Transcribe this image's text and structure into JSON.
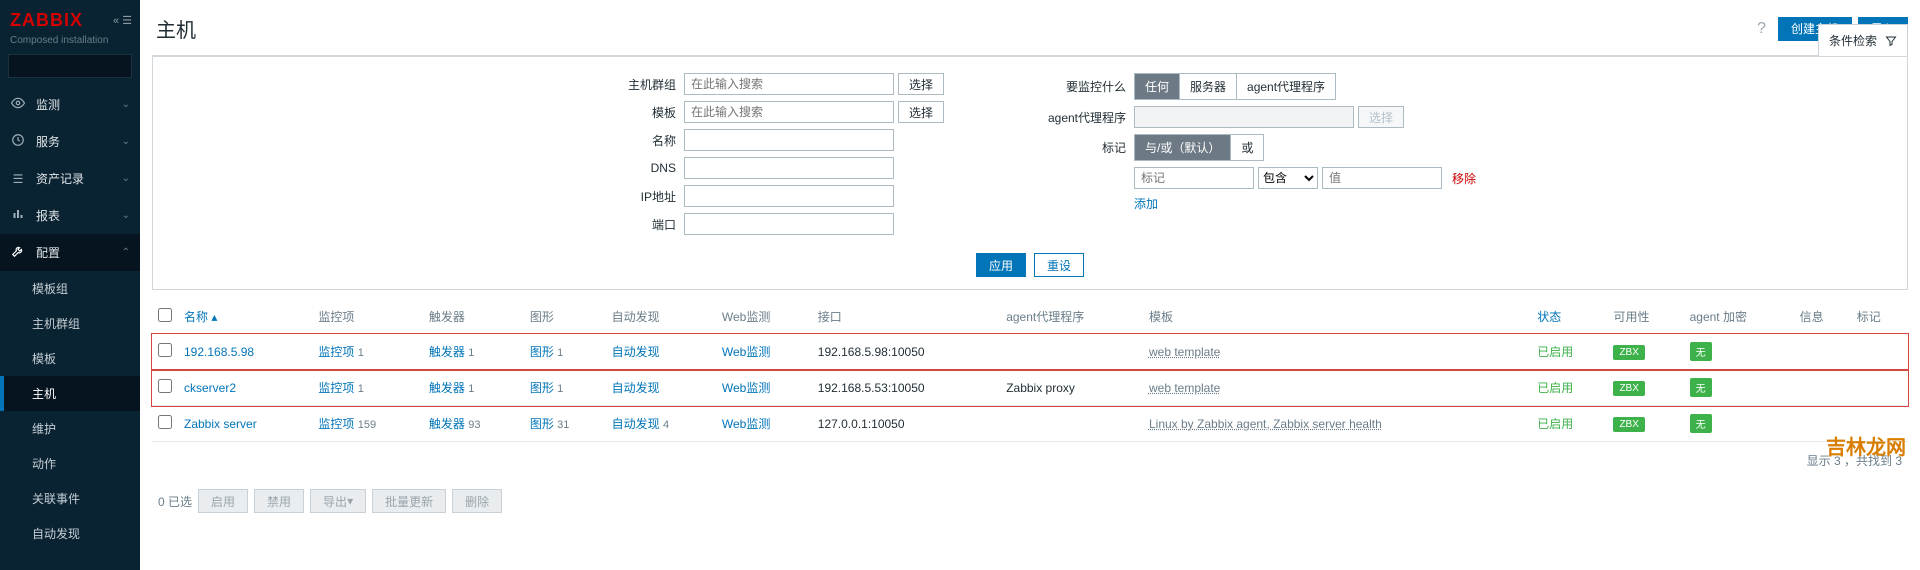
{
  "brand": "ZABBIX",
  "subtitle": "Composed installation",
  "sidebar": {
    "items": [
      {
        "icon": "eye-icon",
        "label": "监测"
      },
      {
        "icon": "clock-icon",
        "label": "服务"
      },
      {
        "icon": "list-icon",
        "label": "资产记录"
      },
      {
        "icon": "chart-icon",
        "label": "报表"
      },
      {
        "icon": "wrench-icon",
        "label": "配置",
        "expanded": true,
        "children": [
          {
            "label": "模板组"
          },
          {
            "label": "主机群组"
          },
          {
            "label": "模板"
          },
          {
            "label": "主机",
            "active": true
          },
          {
            "label": "维护"
          },
          {
            "label": "动作"
          },
          {
            "label": "关联事件"
          },
          {
            "label": "自动发现"
          }
        ]
      }
    ]
  },
  "header": {
    "title": "主机",
    "create_btn": "创建主机",
    "import_btn": "导入"
  },
  "filter": {
    "toggle_label": "条件检索",
    "left": {
      "hostgroup_label": "主机群组",
      "template_label": "模板",
      "name_label": "名称",
      "dns_label": "DNS",
      "ip_label": "IP地址",
      "port_label": "端口",
      "placeholder": "在此输入搜索",
      "select_btn": "选择"
    },
    "right": {
      "monitor_label": "要监控什么",
      "monitor_opts": [
        "任何",
        "服务器",
        "agent代理程序"
      ],
      "proxy_label": "agent代理程序",
      "proxy_select": "选择",
      "tags_label": "标记",
      "tags_mode": [
        "与/或（默认）",
        "或"
      ],
      "tag_key_ph": "标记",
      "tag_op": "包含",
      "tag_val_ph": "值",
      "tag_remove": "移除",
      "tag_add": "添加"
    },
    "apply_btn": "应用",
    "reset_btn": "重设"
  },
  "table": {
    "cols": {
      "name": "名称",
      "items": "监控项",
      "triggers": "触发器",
      "graphs": "图形",
      "discovery": "自动发现",
      "web": "Web监测",
      "interface": "接口",
      "proxy": "agent代理程序",
      "template": "模板",
      "status": "状态",
      "availability": "可用性",
      "encryption": "agent 加密",
      "info": "信息",
      "tags": "标记"
    },
    "rows": [
      {
        "name": "192.168.5.98",
        "items": "监控项",
        "items_n": "1",
        "triggers": "触发器",
        "triggers_n": "1",
        "graphs": "图形",
        "graphs_n": "1",
        "discovery": "自动发现",
        "discovery_n": "",
        "web": "Web监测",
        "web_n": "",
        "interface": "192.168.5.98:10050",
        "proxy": "",
        "template": "web template",
        "status": "已启用",
        "avail": "ZBX",
        "enc": "无"
      },
      {
        "name": "ckserver2",
        "items": "监控项",
        "items_n": "1",
        "triggers": "触发器",
        "triggers_n": "1",
        "graphs": "图形",
        "graphs_n": "1",
        "discovery": "自动发现",
        "discovery_n": "",
        "web": "Web监测",
        "web_n": "",
        "interface": "192.168.5.53:10050",
        "proxy": "Zabbix proxy",
        "template": "web template",
        "status": "已启用",
        "avail": "ZBX",
        "enc": "无"
      },
      {
        "name": "Zabbix server",
        "items": "监控项",
        "items_n": "159",
        "triggers": "触发器",
        "triggers_n": "93",
        "graphs": "图形",
        "graphs_n": "31",
        "discovery": "自动发现",
        "discovery_n": "4",
        "web": "Web监测",
        "web_n": "",
        "interface": "127.0.0.1:10050",
        "proxy": "",
        "template": "Linux by Zabbix agent, Zabbix server health",
        "status": "已启用",
        "avail": "ZBX",
        "enc": "无"
      }
    ],
    "footer": "显示 3 ，共找到 3"
  },
  "mass": {
    "selected": "0 已选",
    "enable": "启用",
    "disable": "禁用",
    "export": "导出",
    "mass_update": "批量更新",
    "delete": "删除"
  },
  "watermark": "吉林龙网"
}
